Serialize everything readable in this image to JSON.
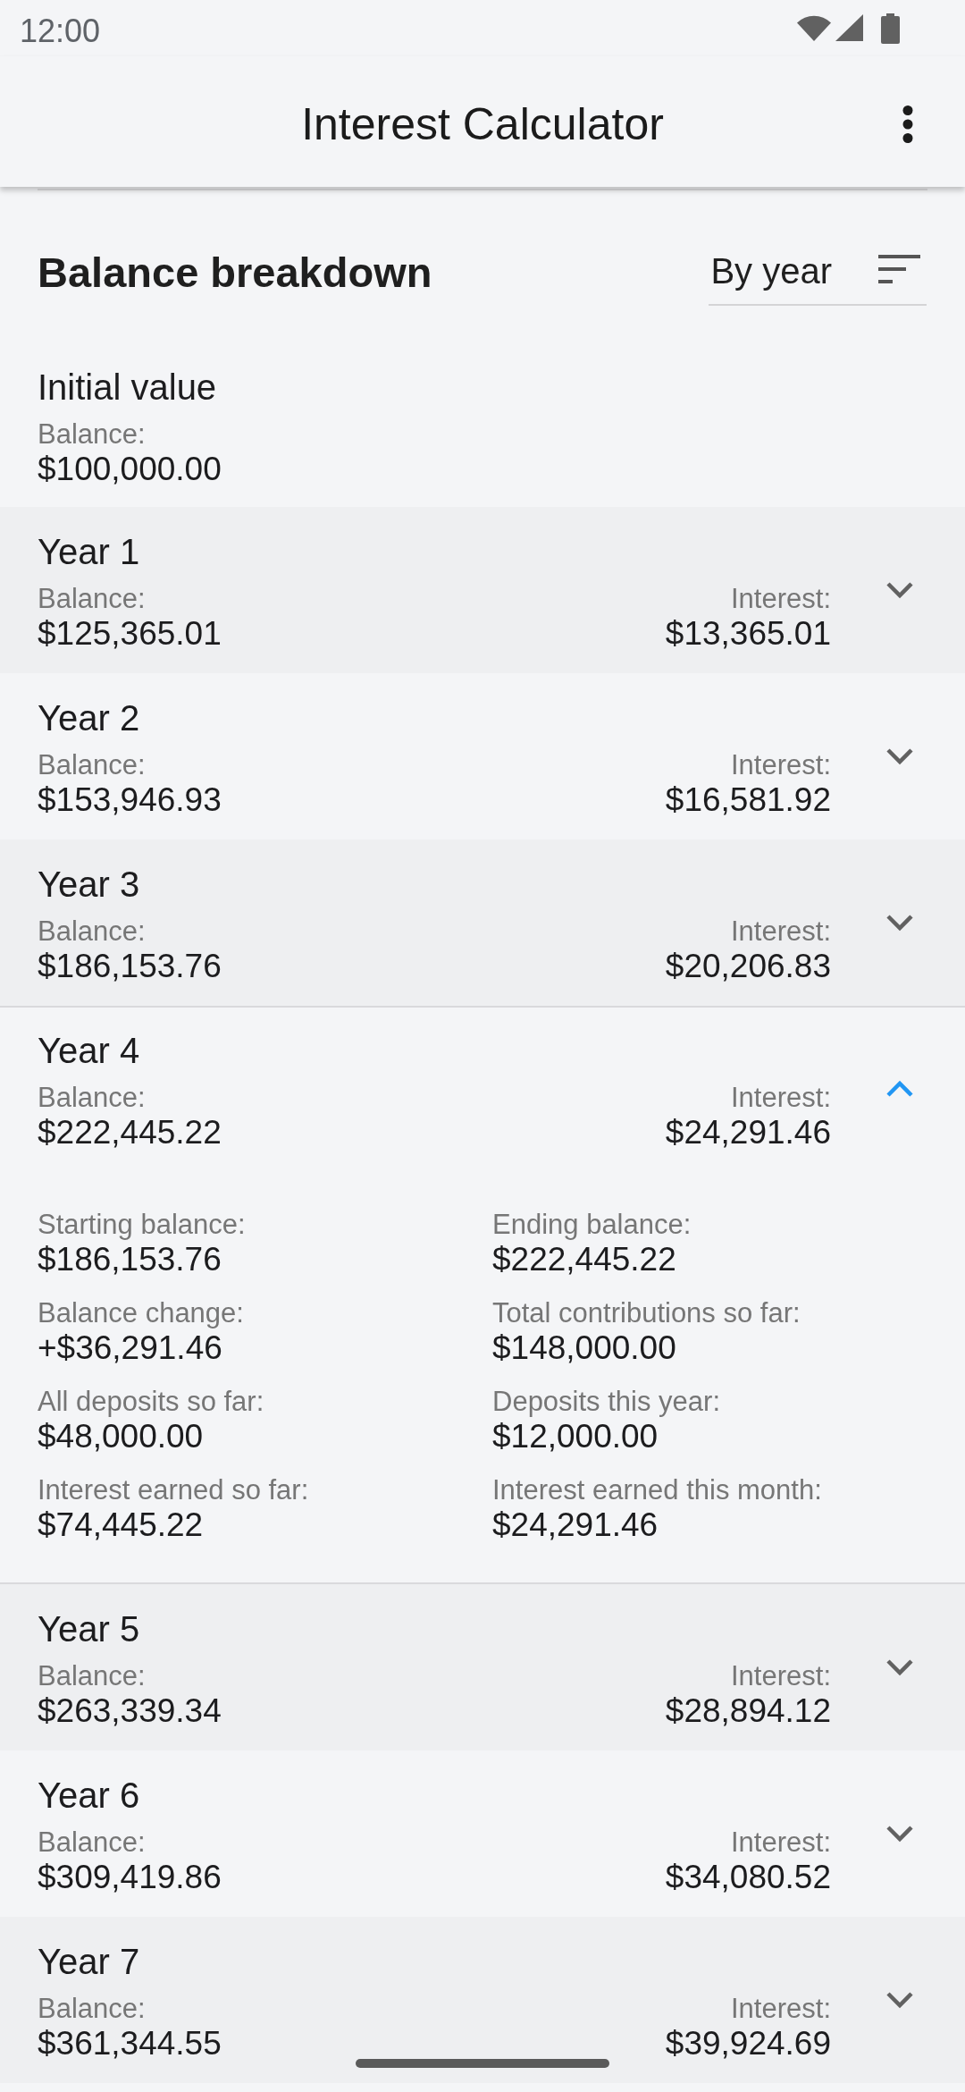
{
  "status_bar": {
    "time": "12:00"
  },
  "app_bar": {
    "title": "Interest Calculator"
  },
  "breakdown": {
    "title": "Balance breakdown",
    "period_dropdown": {
      "value": "By year"
    }
  },
  "initial": {
    "title": "Initial value",
    "balance_label": "Balance:",
    "balance": "$100,000.00"
  },
  "years": [
    {
      "title": "Year 1",
      "balance_label": "Balance:",
      "balance": "$125,365.01",
      "interest_label": "Interest:",
      "interest": "$13,365.01",
      "expanded": false
    },
    {
      "title": "Year 2",
      "balance_label": "Balance:",
      "balance": "$153,946.93",
      "interest_label": "Interest:",
      "interest": "$16,581.92",
      "expanded": false
    },
    {
      "title": "Year 3",
      "balance_label": "Balance:",
      "balance": "$186,153.76",
      "interest_label": "Interest:",
      "interest": "$20,206.83",
      "expanded": false
    },
    {
      "title": "Year 4",
      "balance_label": "Balance:",
      "balance": "$222,445.22",
      "interest_label": "Interest:",
      "interest": "$24,291.46",
      "expanded": true,
      "details": [
        {
          "label": "Starting balance:",
          "value": "$186,153.76"
        },
        {
          "label": "Ending balance:",
          "value": "$222,445.22"
        },
        {
          "label": "Balance change:",
          "value": "+$36,291.46"
        },
        {
          "label": "Total contributions so far:",
          "value": "$148,000.00"
        },
        {
          "label": "All deposits so far:",
          "value": "$48,000.00"
        },
        {
          "label": "Deposits this year:",
          "value": "$12,000.00"
        },
        {
          "label": "Interest earned so far:",
          "value": "$74,445.22"
        },
        {
          "label": "Interest earned this month:",
          "value": "$24,291.46"
        }
      ]
    },
    {
      "title": "Year 5",
      "balance_label": "Balance:",
      "balance": "$263,339.34",
      "interest_label": "Interest:",
      "interest": "$28,894.12",
      "expanded": false
    },
    {
      "title": "Year 6",
      "balance_label": "Balance:",
      "balance": "$309,419.86",
      "interest_label": "Interest:",
      "interest": "$34,080.52",
      "expanded": false
    },
    {
      "title": "Year 7",
      "balance_label": "Balance:",
      "balance": "$361,344.55",
      "interest_label": "Interest:",
      "interest": "$39,924.69",
      "expanded": false
    }
  ]
}
